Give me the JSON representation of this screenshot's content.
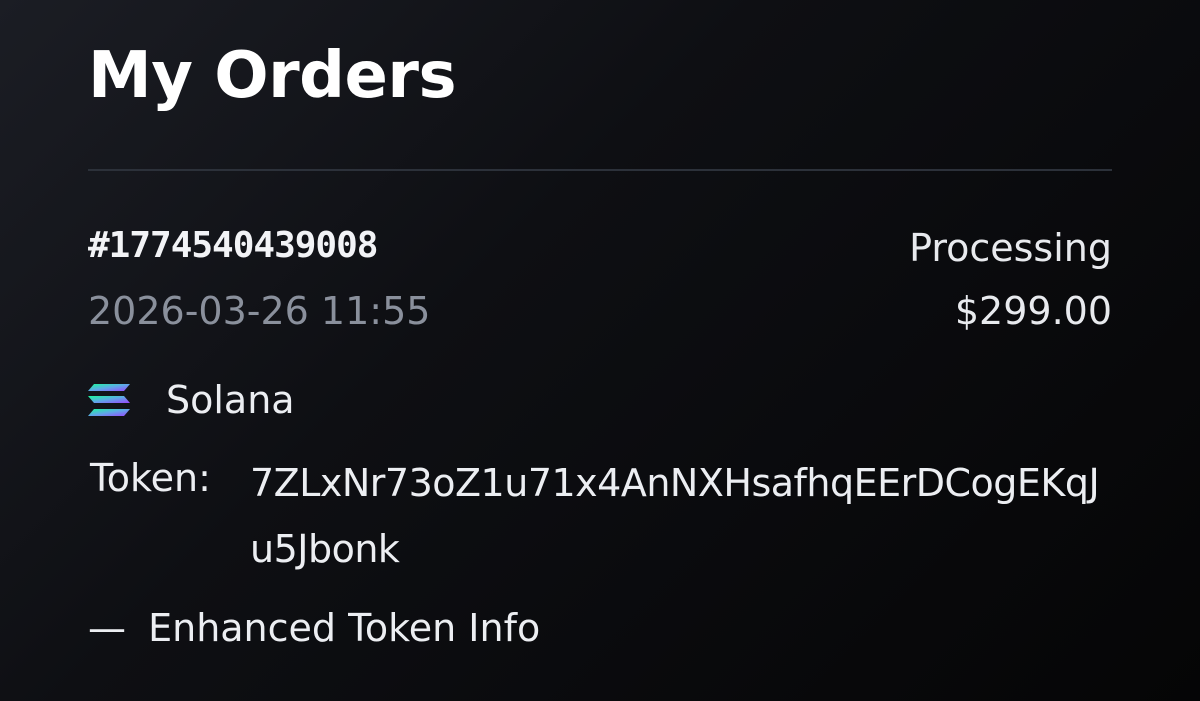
{
  "header": {
    "title": "My Orders"
  },
  "order": {
    "number": "#1774540439008",
    "date": "2026-03-26 11:55",
    "status": "Processing",
    "amount": "$299.00",
    "chain": {
      "name": "Solana",
      "icon": "solana-icon"
    },
    "token": {
      "label": "Token:",
      "address": "7ZLxNr73oZ1u71x4AnNXHsafhqEErDCogEKqJu5Jbonk"
    },
    "enhanced_info": {
      "marker": "—",
      "label": "Enhanced Token Info"
    }
  },
  "colors": {
    "background": "#0e0f13",
    "text": "#eceef2",
    "muted": "#8a909c",
    "divider": "#2c313a"
  }
}
